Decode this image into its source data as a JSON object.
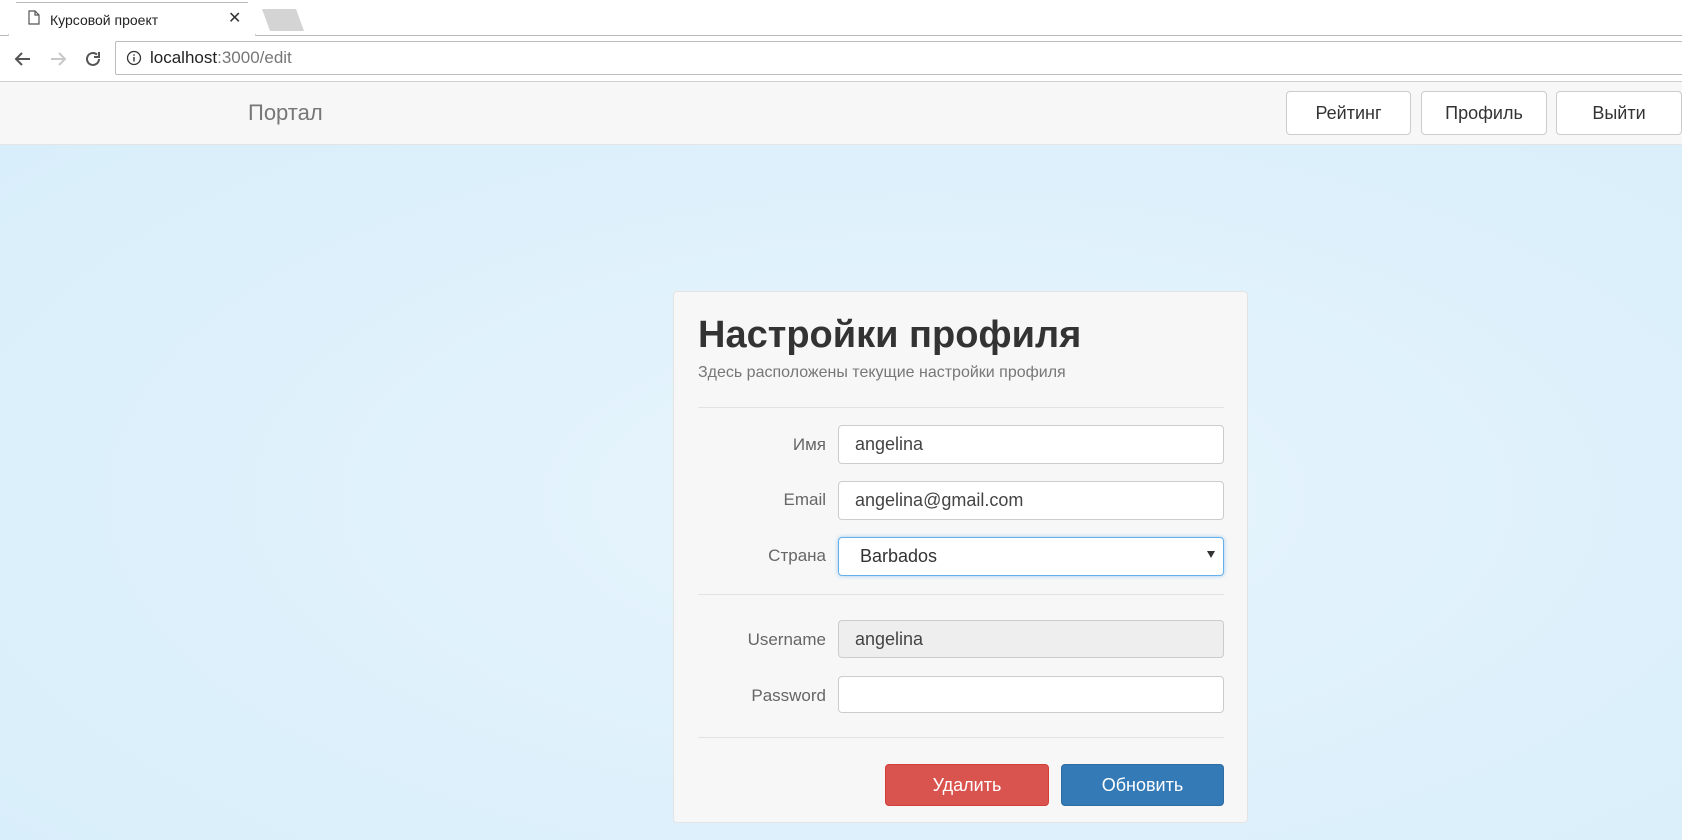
{
  "browser": {
    "tab_title": "Курсовой проект",
    "url_host": "localhost",
    "url_path": ":3000/edit"
  },
  "navbar": {
    "brand": "Портал",
    "buttons": [
      "Рейтинг",
      "Профиль",
      "Выйти"
    ]
  },
  "form": {
    "title": "Настройки профиля",
    "subtitle": "Здесь расположены текущие настройки профиля",
    "fields": {
      "name": {
        "label": "Имя",
        "value": "angelina"
      },
      "email": {
        "label": "Email",
        "value": "angelina@gmail.com"
      },
      "country": {
        "label": "Страна",
        "value": "Barbados"
      },
      "username": {
        "label": "Username",
        "value": "angelina"
      },
      "password": {
        "label": "Password",
        "value": ""
      }
    },
    "delete_label": "Удалить",
    "update_label": "Обновить"
  },
  "colors": {
    "danger": "#d9534f",
    "primary": "#337ab7",
    "page_background": "#ddf0fb"
  },
  "icons": [
    "page-icon",
    "close-icon",
    "back-icon",
    "forward-icon",
    "reload-icon",
    "info-icon",
    "chevron-down-icon"
  ]
}
